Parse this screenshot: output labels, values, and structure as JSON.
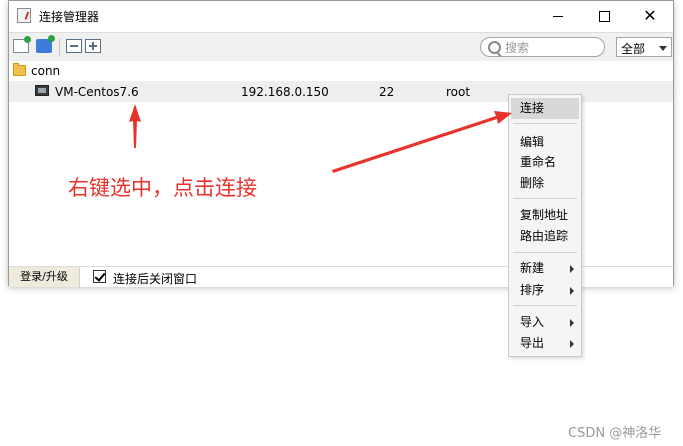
{
  "window": {
    "title": "连接管理器",
    "controls": {
      "minimize": "",
      "maximize": "",
      "close": "✕"
    }
  },
  "toolbar": {
    "icons": [
      "new-connection-icon",
      "new-folder-icon",
      "collapse-all-icon",
      "expand-all-icon"
    ],
    "search_placeholder": "搜索",
    "filter_value": "全部"
  },
  "tree": {
    "root": {
      "label": "conn",
      "icon": "folder-icon"
    },
    "connections": [
      {
        "name": "VM-Centos7.6",
        "host": "192.168.0.150",
        "port": "22",
        "user": "root",
        "icon": "monitor-icon"
      }
    ]
  },
  "statusbar": {
    "login_tab": "登录/升级",
    "close_after_connect_label": "连接后关闭窗口",
    "close_after_connect_checked": true
  },
  "context_menu": {
    "connect": "连接",
    "edit": "编辑",
    "rename": "重命名",
    "delete": "删除",
    "copy_address": "复制地址",
    "traceroute": "路由追踪",
    "new": "新建",
    "sort": "排序",
    "import": "导入",
    "export": "导出"
  },
  "annotation": {
    "text": "右键选中，点击连接",
    "color": "#e8322b"
  },
  "watermark": "CSDN @神洛华"
}
